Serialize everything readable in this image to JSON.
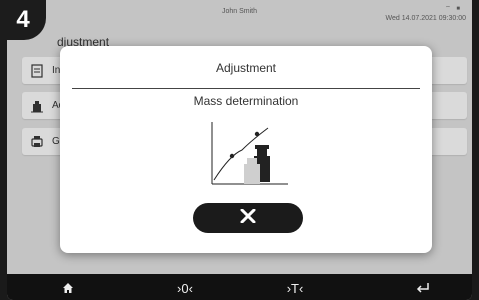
{
  "status": {
    "user": "John Smith",
    "datetime": "Wed 14.07.2021  09:30:00",
    "icons": [
      "wifi-icon",
      "battery-icon"
    ]
  },
  "step_badge": "4",
  "page": {
    "title_visible": "djustment"
  },
  "menu": [
    {
      "label": "Inte",
      "icon": "document-icon"
    },
    {
      "label": "Adj",
      "icon": "weight-icon"
    },
    {
      "label": "GLI",
      "icon": "printer-icon"
    }
  ],
  "dialog": {
    "title": "Adjustment",
    "subtitle": "Mass determination",
    "illustration": "mass-curve-icon",
    "cancel_icon": "close-icon"
  },
  "bottom_bar": {
    "home": "home-icon",
    "zero_label": "›0‹",
    "tare_label": "›T‹",
    "enter": "enter-icon"
  },
  "colors": {
    "dark": "#1b1b1b",
    "background": "#cfcfcf",
    "dialog": "#ffffff"
  }
}
